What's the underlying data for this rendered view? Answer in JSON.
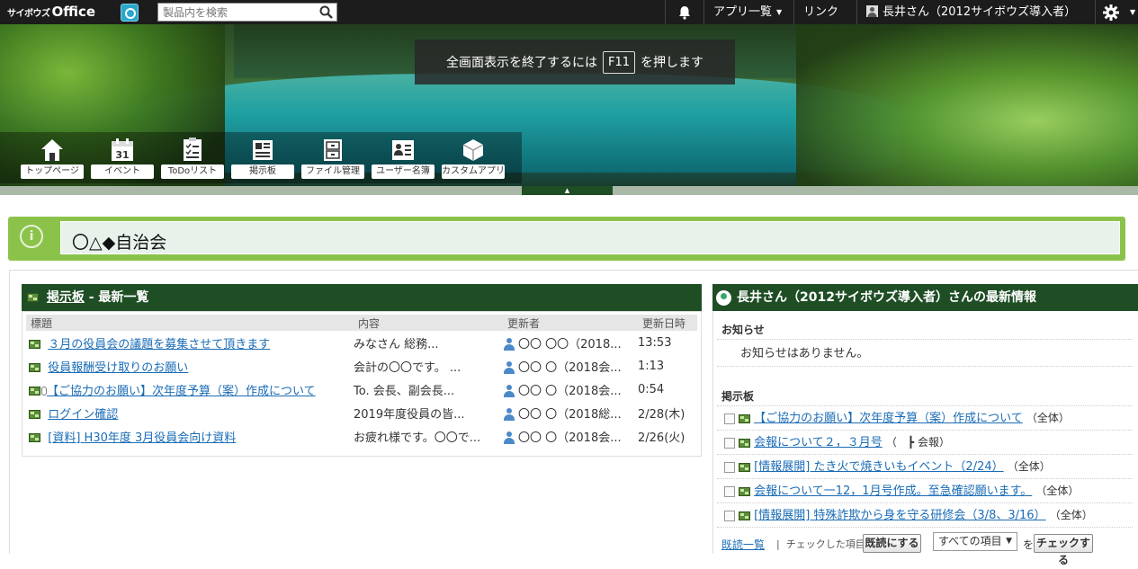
{
  "topbar": {
    "logo_small": "サイボウズ",
    "logo_main": "Office",
    "search_placeholder": "製品内を検索",
    "apps_menu": "アプリ一覧",
    "links_menu": "リンク",
    "user_name": "長井さん（2012サイボウズ導入者）"
  },
  "banner": {
    "fullscreen_prefix": "全画面表示を終了するには",
    "fullscreen_key": "F11",
    "fullscreen_suffix": "を押します",
    "apps": [
      {
        "label": "トップページ",
        "icon": "house-icon"
      },
      {
        "label": "イベント",
        "icon": "calendar-icon",
        "day": "31"
      },
      {
        "label": "ToDoリスト",
        "icon": "checklist-icon"
      },
      {
        "label": "掲示板",
        "icon": "bulletin-board-icon"
      },
      {
        "label": "ファイル管理",
        "icon": "file-cabinet-icon"
      },
      {
        "label": "ユーザー名簿",
        "icon": "user-directory-icon"
      },
      {
        "label": "カスタムアプリ",
        "icon": "custom-app-icon"
      }
    ]
  },
  "page": {
    "title": "〇△◆自治会"
  },
  "board": {
    "title_link": "掲示板",
    "title_suffix": " - 最新一覧",
    "columns": {
      "title": "標題",
      "content": "内容",
      "author": "更新者",
      "updated": "更新日時"
    },
    "rows": [
      {
        "title": "３月の役員会の議題を募集させて頂きます",
        "content": "みなさん 総務...",
        "author": "〇〇 〇〇（2018...",
        "updated": "13:53",
        "attachment": false
      },
      {
        "title": "役員報酬受け取りのお願い",
        "content": "会計の〇〇です。 ...",
        "author": "〇〇 〇（2018会...",
        "updated": "1:13",
        "attachment": false
      },
      {
        "title": "【ご協力のお願い】次年度予算（案）作成について",
        "content": "To. 会長、副会長...",
        "author": "〇〇 〇（2018会...",
        "updated": "0:54",
        "attachment": true
      },
      {
        "title": "ログイン確認",
        "content": "2019年度役員の皆...",
        "author": "〇〇 〇（2018総...",
        "updated": "2/28(木)",
        "attachment": false
      },
      {
        "title": "[資料] H30年度 3月役員会向け資料",
        "content": "お疲れ様です。〇〇で...",
        "author": "〇〇 〇（2018会...",
        "updated": "2/26(火)",
        "attachment": false
      }
    ]
  },
  "news": {
    "title": "長井さん（2012サイボウズ導入者）さんの最新情報",
    "notice_heading": "お知らせ",
    "notice_empty": "お知らせはありません。",
    "board_heading": "掲示板",
    "items": [
      {
        "title": "【ご協力のお願い】次年度予算（案）作成について",
        "scope": "（全体）"
      },
      {
        "title": "会報について２，３月号",
        "scope": "（　┣ 会報）"
      },
      {
        "title": "[情報展開] たき火で焼きいもイベント（2/24）",
        "scope": "（全体）"
      },
      {
        "title": "会報について一12，1月号作成。至急確認願います。",
        "scope": "（全体）"
      },
      {
        "title": "[情報展開] 特殊詐欺から身を守る研修会（3/8、3/16）",
        "scope": "（全体）"
      }
    ],
    "read_list_link": "既読一覧",
    "checked_label": "チェックした項目を",
    "mark_read_button": "既読にする",
    "filter_value": "すべての項目",
    "filter_suffix": "を",
    "check_button": "チェックする"
  }
}
